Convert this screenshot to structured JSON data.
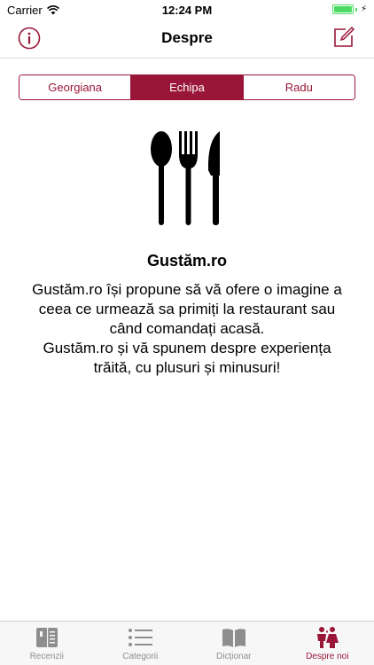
{
  "status_bar": {
    "carrier": "Carrier",
    "time": "12:24 PM"
  },
  "nav": {
    "title": "Despre",
    "left_icon": "info-icon",
    "right_icon": "compose-icon"
  },
  "segments": [
    {
      "label": "Georgiana",
      "selected": false
    },
    {
      "label": "Echipa",
      "selected": true
    },
    {
      "label": "Radu",
      "selected": false
    }
  ],
  "content": {
    "logo_icon": "cutlery-icon",
    "title": "Gustăm.ro",
    "description": "Gustăm.ro își propune să vă ofere o imagine a\nceea ce urmează sa primiți la restaurant sau\ncând comandați acasă.\nGustăm.ro și vă spunem despre experiența\ntrăită, cu plusuri și minusuri!"
  },
  "tabs": [
    {
      "label": "Recenzii",
      "icon": "menu-book-icon",
      "active": false
    },
    {
      "label": "Categorii",
      "icon": "list-icon",
      "active": false
    },
    {
      "label": "Dicționar",
      "icon": "open-book-icon",
      "active": false
    },
    {
      "label": "Despre noi",
      "icon": "people-icon",
      "active": true
    }
  ],
  "colors": {
    "accent": "#9a1638",
    "battery": "#4cd964",
    "tab_inactive": "#8e8e8e"
  }
}
